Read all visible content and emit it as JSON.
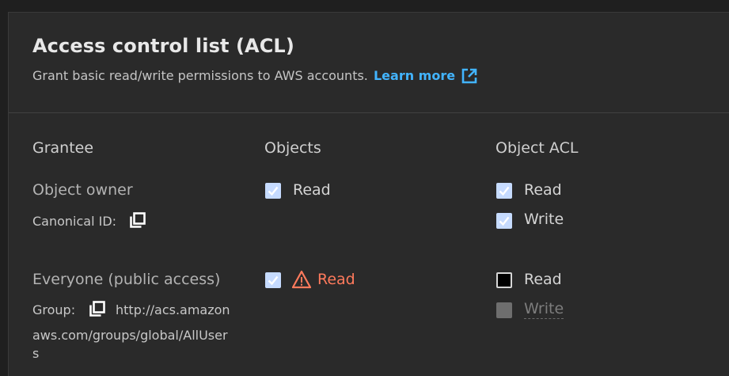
{
  "acl": {
    "title": "Access control list (ACL)",
    "description": "Grant basic read/write permissions to AWS accounts.",
    "learn_more": "Learn more"
  },
  "columns": {
    "grantee": "Grantee",
    "objects": "Objects",
    "object_acl": "Object ACL"
  },
  "rows": {
    "owner": {
      "title": "Object owner",
      "id_label": "Canonical ID:",
      "objects_read": "Read",
      "acl_read": "Read",
      "acl_write": "Write"
    },
    "everyone": {
      "title": "Everyone (public access)",
      "group_label": "Group:",
      "group_uri_line1": "http://acs.amazon",
      "group_uri_line2": "aws.com/groups/global/AllUser",
      "group_uri_line3": "s",
      "objects_read": "Read",
      "acl_read": "Read",
      "acl_write": "Write"
    }
  },
  "state": {
    "owner_objects_read": true,
    "owner_acl_read": true,
    "owner_acl_write": true,
    "everyone_objects_read": true,
    "everyone_acl_read": false,
    "everyone_acl_write": "disabled"
  },
  "colors": {
    "link": "#42b4ff",
    "warning": "#ff7a5c",
    "checkbox_checked": "#c6dbff"
  }
}
